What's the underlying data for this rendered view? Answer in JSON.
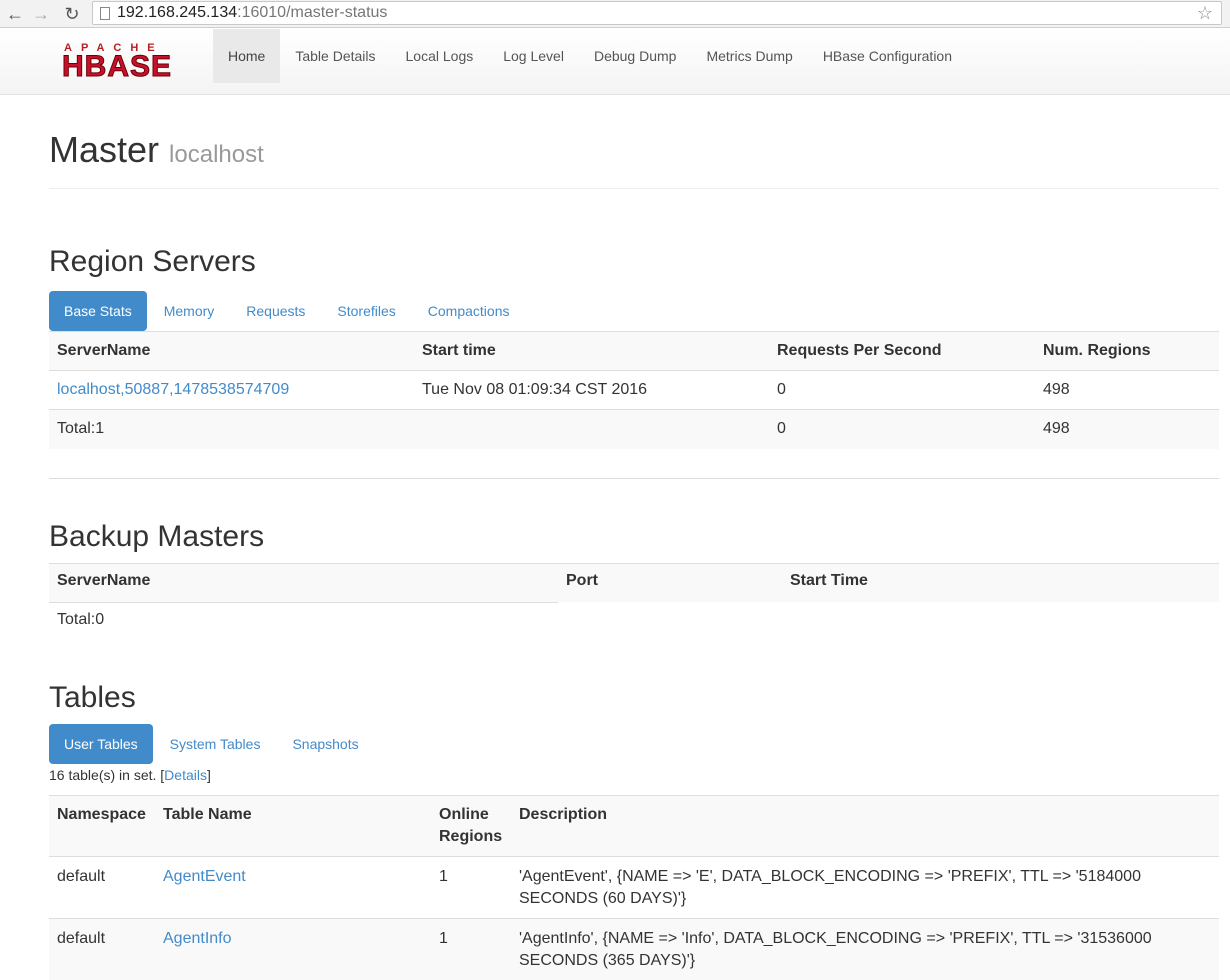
{
  "browser": {
    "url_host": "192.168.245.134",
    "url_rest": ":16010/master-status"
  },
  "navbar": {
    "logo_top": "APACHE",
    "logo_main": "HBASE",
    "items": [
      "Home",
      "Table Details",
      "Local Logs",
      "Log Level",
      "Debug Dump",
      "Metrics Dump",
      "HBase Configuration"
    ]
  },
  "header": {
    "title": "Master",
    "subtitle": "localhost"
  },
  "region_servers": {
    "heading": "Region Servers",
    "tabs": [
      "Base Stats",
      "Memory",
      "Requests",
      "Storefiles",
      "Compactions"
    ],
    "columns": [
      "ServerName",
      "Start time",
      "Requests Per Second",
      "Num. Regions"
    ],
    "rows": [
      [
        "localhost,50887,1478538574709",
        "Tue Nov 08 01:09:34 CST 2016",
        "0",
        "498"
      ]
    ],
    "total": [
      "Total:1",
      "",
      "0",
      "498"
    ]
  },
  "backup_masters": {
    "heading": "Backup Masters",
    "columns": [
      "ServerName",
      "Port",
      "Start Time"
    ],
    "total": "Total:0"
  },
  "tables": {
    "heading": "Tables",
    "tabs": [
      "User Tables",
      "System Tables",
      "Snapshots"
    ],
    "count_text": "16 table(s) in set. [",
    "details_link": "Details",
    "count_suffix": "]",
    "columns": [
      "Namespace",
      "Table Name",
      "Online Regions",
      "Description"
    ],
    "rows": [
      [
        "default",
        "AgentEvent",
        "1",
        "'AgentEvent', {NAME => 'E', DATA_BLOCK_ENCODING => 'PREFIX', TTL => '5184000 SECONDS (60 DAYS)'}"
      ],
      [
        "default",
        "AgentInfo",
        "1",
        "'AgentInfo', {NAME => 'Info', DATA_BLOCK_ENCODING => 'PREFIX', TTL => '31536000 SECONDS (365 DAYS)'}"
      ]
    ]
  }
}
